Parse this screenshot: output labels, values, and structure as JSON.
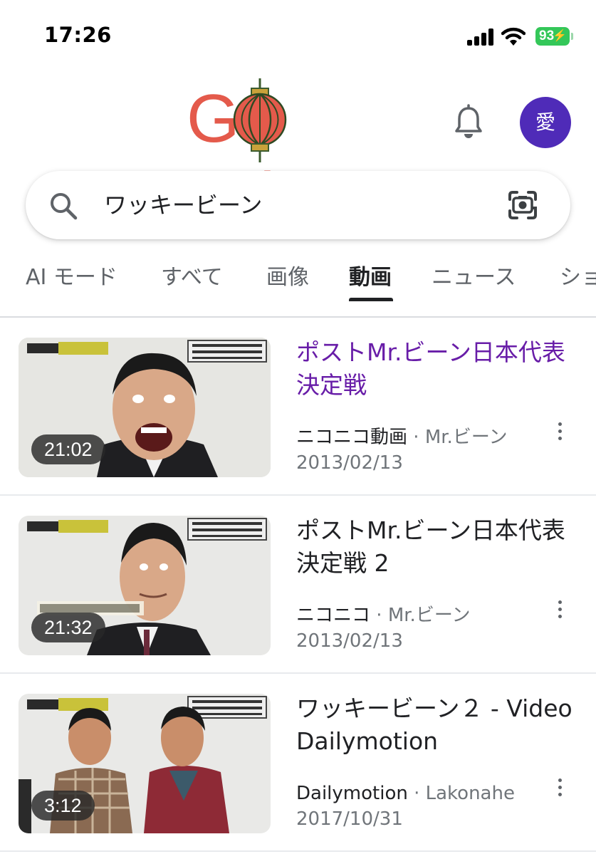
{
  "status_bar": {
    "time": "17:26",
    "battery": "93"
  },
  "header": {
    "logo_text": "Google",
    "avatar_initial": "愛"
  },
  "search": {
    "query": "ワッキービーン"
  },
  "tabs": [
    {
      "label": "AI モード",
      "active": false
    },
    {
      "label": "すべて",
      "active": false
    },
    {
      "label": "画像",
      "active": false
    },
    {
      "label": "動画",
      "active": true
    },
    {
      "label": "ニュース",
      "active": false
    },
    {
      "label": "ショ",
      "active": false
    }
  ],
  "results": [
    {
      "title": "ポストMr.ビーン日本代表決定戦",
      "visited": true,
      "source": "ニコニコ動画",
      "author": "Mr.ビーン",
      "date": "2013/02/13",
      "duration": "21:02"
    },
    {
      "title": "ポストMr.ビーン日本代表決定戦 2",
      "visited": false,
      "source": "ニコニコ",
      "author": "Mr.ビーン",
      "date": "2013/02/13",
      "duration": "21:32"
    },
    {
      "title": "ワッキービーン２ - Video Dailymotion",
      "visited": false,
      "source": "Dailymotion",
      "author": "Lakonahe",
      "date": "2017/10/31",
      "duration": "3:12"
    }
  ],
  "colors": {
    "logo": "#e45a4b",
    "visited_link": "#681da8",
    "avatar_bg": "#4f2bb8",
    "battery": "#34c759"
  }
}
